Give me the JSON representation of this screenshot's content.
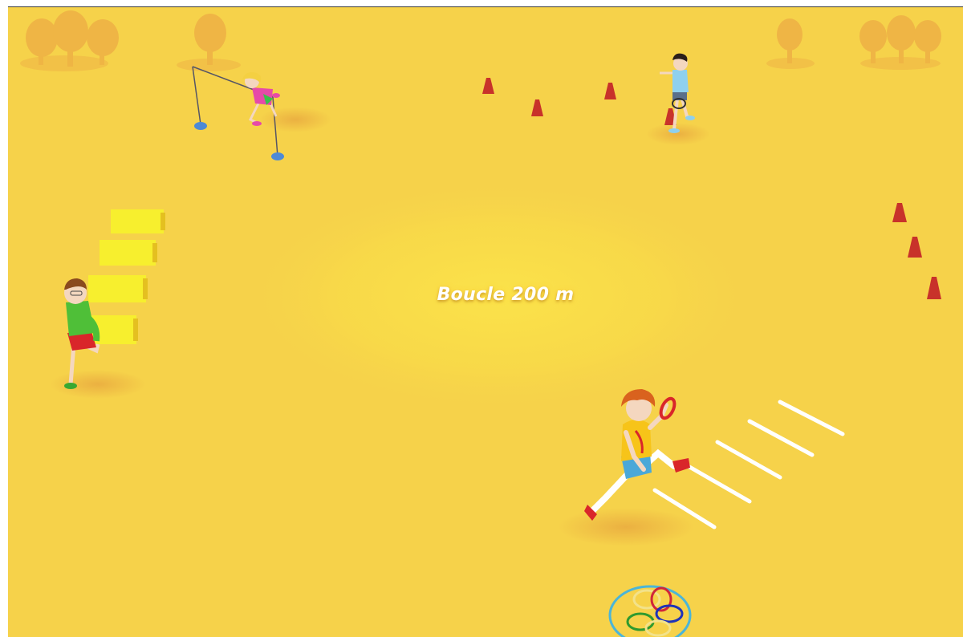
{
  "scene": {
    "loop_label": "Boucle 200 m",
    "colors": {
      "ground": "#f6d24a",
      "ground_glow": "#fbe34a",
      "tree": "#eeb145",
      "cone": "#c8322a",
      "hurdle": "#f7ef2e",
      "pole_base": "#4d8ad6",
      "ladder_bar": "#ffffff",
      "hoop_outline": "#4bb5d8"
    },
    "stations": [
      {
        "name": "hurdles-station",
        "icon": "hurdle-icon",
        "count": 4
      },
      {
        "name": "high-jump-station",
        "icon": "high-jump-bar-icon"
      },
      {
        "name": "slalom-cones-top",
        "icon": "cone-icon",
        "count": 4
      },
      {
        "name": "slalom-cones-right",
        "icon": "cone-icon",
        "count": 3
      },
      {
        "name": "ladder-station",
        "icon": "ground-ladder-icon",
        "count": 5
      },
      {
        "name": "hoops-station",
        "icon": "hoop-icon",
        "count": 5
      }
    ],
    "characters": [
      {
        "name": "runner-green-shirt",
        "shirt": "#4fbf38"
      },
      {
        "name": "jumper-pink-outfit",
        "shirt": "#e64aa8"
      },
      {
        "name": "runner-blue-shirt",
        "shirt": "#8fd0ee"
      },
      {
        "name": "runner-yellow-shirt",
        "shirt": "#f7c419"
      }
    ]
  }
}
